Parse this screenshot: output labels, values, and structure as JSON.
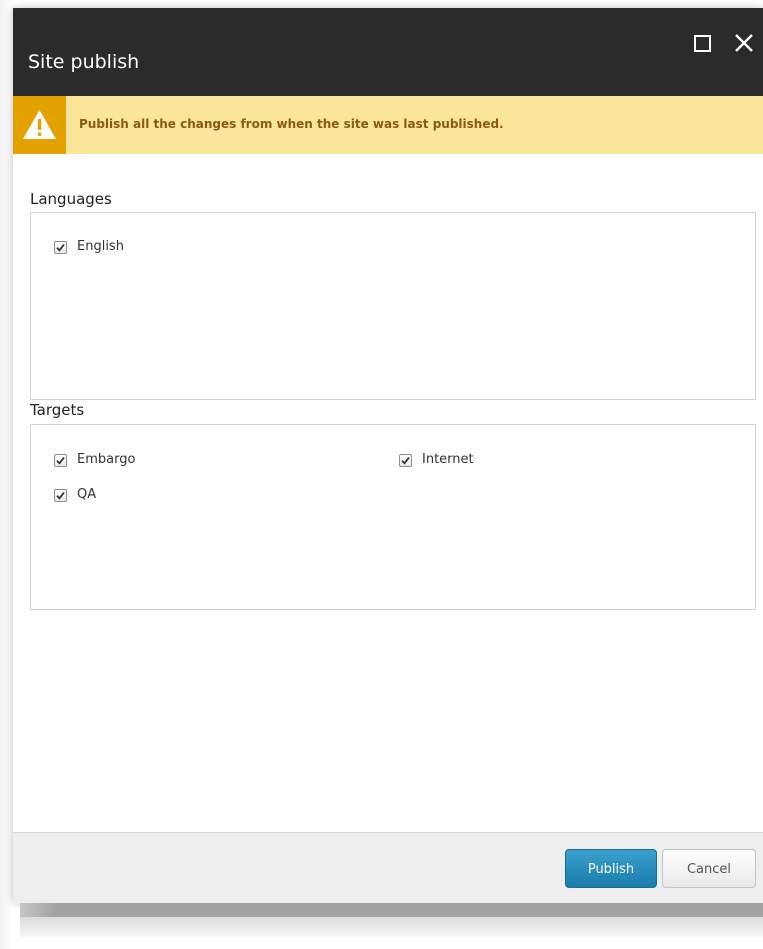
{
  "dialog": {
    "title": "Site publish",
    "maximize_icon": "maximize-icon",
    "close_icon": "close-icon"
  },
  "warning": {
    "icon": "warning-icon",
    "message": "Publish all the changes from when the site was last published.",
    "background_color": "#fbe59b",
    "icon_background_color": "#e3a200"
  },
  "languages": {
    "label": "Languages",
    "items": [
      {
        "label": "English",
        "checked": true
      }
    ]
  },
  "targets": {
    "label": "Targets",
    "items": [
      {
        "label": "Embargo",
        "checked": true
      },
      {
        "label": "Internet",
        "checked": true
      },
      {
        "label": "QA",
        "checked": true
      }
    ]
  },
  "footer": {
    "publish_label": "Publish",
    "cancel_label": "Cancel",
    "publish_color": "#1a7dab"
  }
}
